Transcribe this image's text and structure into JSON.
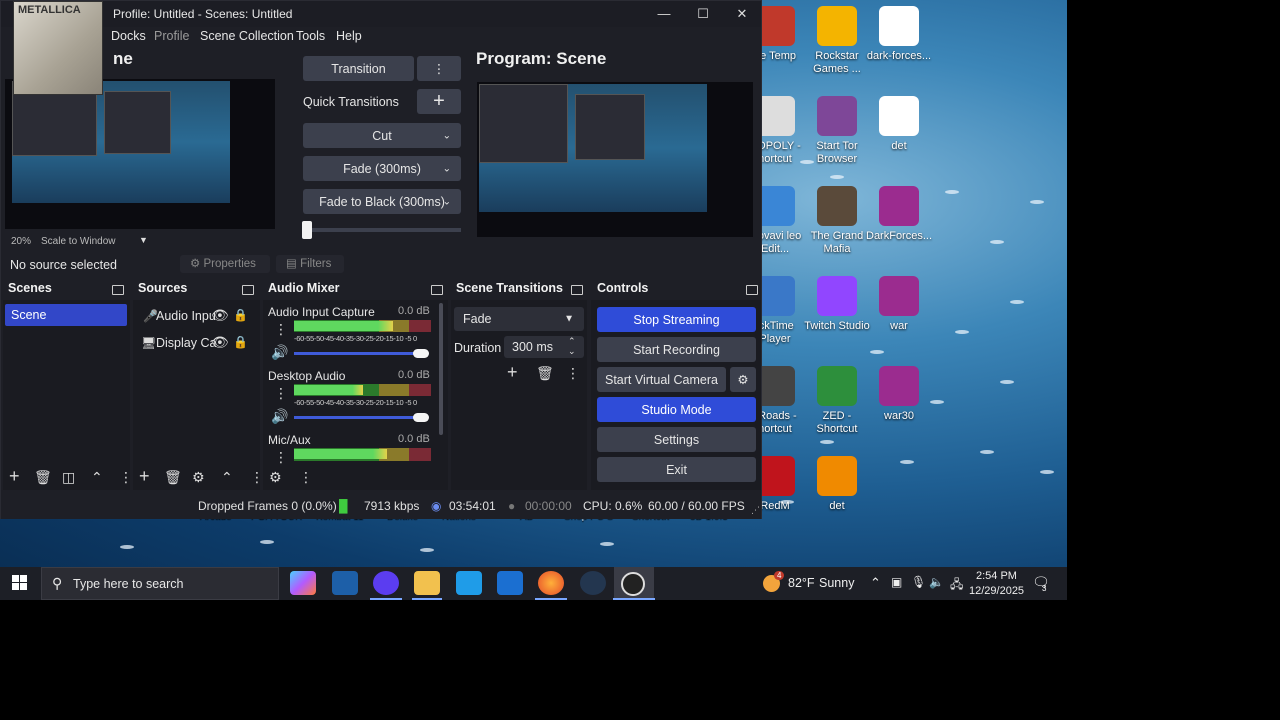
{
  "obs": {
    "title": "Profile: Untitled - Scenes: Untitled",
    "menu": [
      "Docks",
      "Profile",
      "Scene Collection",
      "Tools",
      "Help"
    ],
    "preview_title": "ne",
    "program_title": "Program: Scene",
    "transition_button": "Transition",
    "quick_transitions_label": "Quick Transitions",
    "quick_transitions": [
      "Cut",
      "Fade (300ms)",
      "Fade to Black (300ms)"
    ],
    "zoom": "20%",
    "scale_mode": "Scale to Window",
    "no_source": "No source selected",
    "properties_label": "Properties",
    "filters_label": "Filters"
  },
  "docks": {
    "scenes_title": "Scenes",
    "sources_title": "Sources",
    "mixer_title": "Audio Mixer",
    "transitions_title": "Scene Transitions",
    "controls_title": "Controls"
  },
  "scenes": [
    "Scene"
  ],
  "sources": [
    "Audio Inpu",
    "Display Ca"
  ],
  "mixer": {
    "ticks": "-60-55-50-45-40-35-30-25-20-15-10 -5  0",
    "channels": [
      {
        "name": "Audio Input Capture",
        "db": "0.0 dB",
        "level": 0.72,
        "volume": 0.85
      },
      {
        "name": "Desktop Audio",
        "db": "0.0 dB",
        "level": 0.5,
        "volume": 0.85
      },
      {
        "name": "Mic/Aux",
        "db": "0.0 dB",
        "level": 0.68,
        "volume": 0.85
      }
    ]
  },
  "transitions": {
    "selected": "Fade",
    "duration_label": "Duration",
    "duration_value": "300 ms"
  },
  "controls": {
    "stop_streaming": "Stop Streaming",
    "start_recording": "Start Recording",
    "start_virtual_camera": "Start Virtual Camera",
    "studio_mode": "Studio Mode",
    "settings": "Settings",
    "exit": "Exit"
  },
  "status": {
    "dropped_frames": "Dropped Frames 0 (0.0%)",
    "bitrate": "7913 kbps",
    "stream_time": "03:54:01",
    "record_time": "00:00:00",
    "cpu": "CPU: 0.6%",
    "fps": "60.00 / 60.00 FPS"
  },
  "desktop_icons": [
    {
      "label": "ire Temp",
      "icon": "temp-app-icon",
      "color": "#c0392b"
    },
    {
      "label": "Rockstar Games ...",
      "icon": "rockstar-icon",
      "color": "#f4b400"
    },
    {
      "label": "dark-forces...",
      "icon": "file-icon",
      "color": "#ffffff"
    },
    {
      "label": "NOPOLY - hortcut",
      "icon": "monopoly-icon",
      "color": "#dddddd"
    },
    {
      "label": "Start Tor Browser",
      "icon": "tor-icon",
      "color": "#7e4798"
    },
    {
      "label": "det",
      "icon": "video-file-icon",
      "color": "#ffffff"
    },
    {
      "label": "Movavi leo Edit...",
      "icon": "movavi-icon",
      "color": "#3a86d6"
    },
    {
      "label": "The Grand Mafia",
      "icon": "grand-mafia-icon",
      "color": "#5a4a3a"
    },
    {
      "label": "DarkForces...",
      "icon": "winrar-icon",
      "color": "#9b2c8f"
    },
    {
      "label": "ickTime Player",
      "icon": "quicktime-icon",
      "color": "#3a78c8"
    },
    {
      "label": "Twitch Studio",
      "icon": "twitch-icon",
      "color": "#9146ff"
    },
    {
      "label": "war",
      "icon": "winrar-icon",
      "color": "#9b2c8f"
    },
    {
      "label": "ilRoads - hortcut",
      "icon": "railroads-icon",
      "color": "#444444"
    },
    {
      "label": "ZED - Shortcut",
      "icon": "zed-icon",
      "color": "#2d8f3c"
    },
    {
      "label": "war30",
      "icon": "winrar-icon",
      "color": "#9b2c8f"
    },
    {
      "label": "RedM",
      "icon": "redm-icon",
      "color": "#c0141c"
    },
    {
      "label": "det",
      "icon": "vlc-icon",
      "color": "#f08a00"
    }
  ],
  "desktop_strip": [
    "Arcade",
    "PGA TOUR",
    "Kombat 11",
    "Deluxe",
    "Nations",
    "AD",
    "Shop PC S",
    "Shortcut",
    "3D 1.0.3"
  ],
  "taskbar": {
    "search_placeholder": "Type here to search",
    "weather_temp": "82°F",
    "weather_text": "Sunny",
    "weather_badge": "4",
    "time": "2:54 PM",
    "date": "12/29/2025",
    "notifications": "3"
  }
}
